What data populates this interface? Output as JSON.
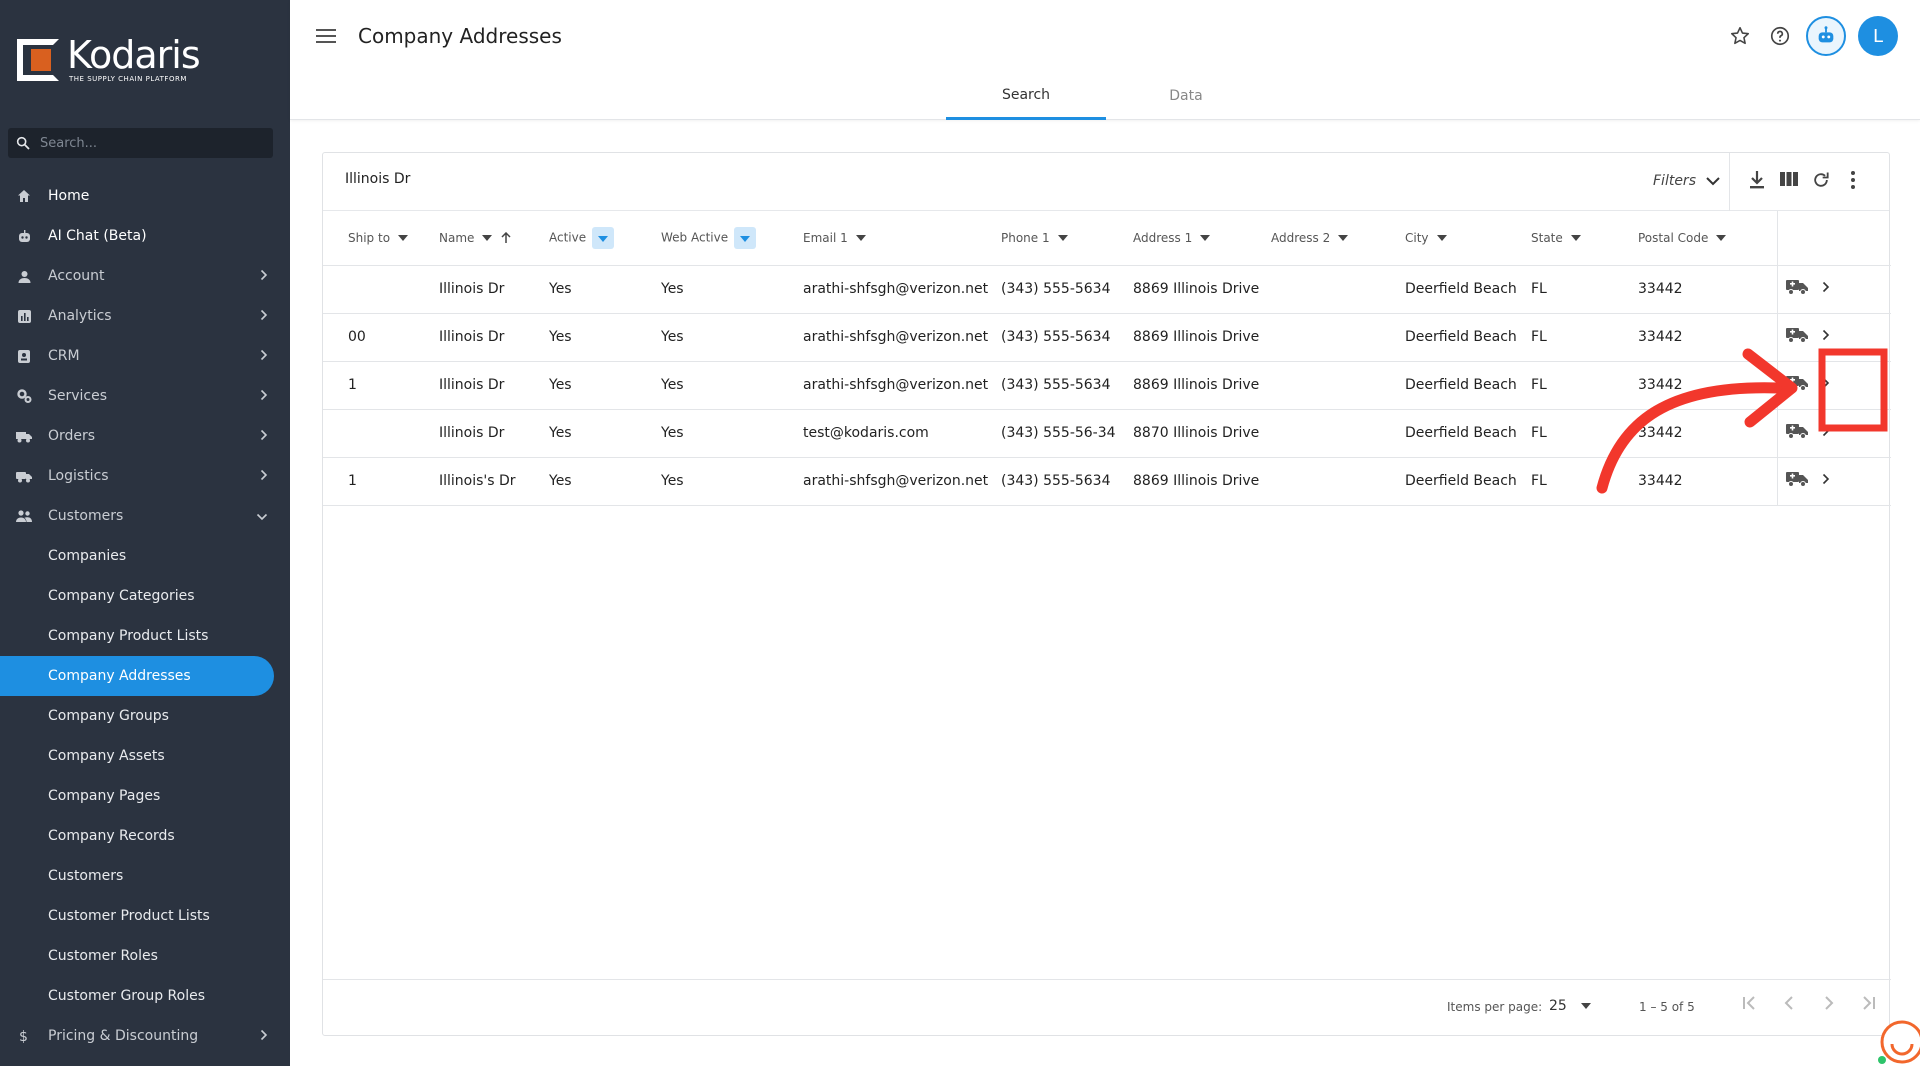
{
  "app": {
    "brand": "Kodaris",
    "tagline": "THE SUPPLY CHAIN PLATFORM"
  },
  "sidebar": {
    "search_placeholder": "Search...",
    "items": [
      {
        "label": "Home",
        "icon": "home-icon",
        "chevron": false
      },
      {
        "label": "AI Chat (Beta)",
        "icon": "robot-icon",
        "chevron": false
      },
      {
        "label": "Account",
        "icon": "person-icon",
        "chevron": true
      },
      {
        "label": "Analytics",
        "icon": "analytics-icon",
        "chevron": true
      },
      {
        "label": "CRM",
        "icon": "contact-icon",
        "chevron": true
      },
      {
        "label": "Services",
        "icon": "services-icon",
        "chevron": true
      },
      {
        "label": "Orders",
        "icon": "truck-icon",
        "chevron": true
      },
      {
        "label": "Logistics",
        "icon": "logistics-icon",
        "chevron": true
      },
      {
        "label": "Customers",
        "icon": "people-icon",
        "chevron": true,
        "expanded": true
      }
    ],
    "sub_items": [
      "Companies",
      "Company Categories",
      "Company Product Lists",
      "Company Addresses",
      "Company Groups",
      "Company Assets",
      "Company Pages",
      "Company Records",
      "Customers",
      "Customer Product Lists",
      "Customer Roles",
      "Customer Group Roles"
    ],
    "active_sub": "Company Addresses",
    "bottom_item": {
      "label": "Pricing & Discounting",
      "icon": "dollar-icon"
    }
  },
  "header": {
    "title": "Company Addresses",
    "tabs": [
      "Search",
      "Data"
    ],
    "active_tab": "Search",
    "avatar_letter": "L"
  },
  "toolbar": {
    "search_value": "Illinois Dr",
    "filters_label": "Filters"
  },
  "table": {
    "columns": [
      "Ship to",
      "Name",
      "Active",
      "Web Active",
      "Email 1",
      "Phone 1",
      "Address 1",
      "Address 2",
      "City",
      "State",
      "Postal Code"
    ],
    "rows": [
      [
        "",
        "Illinois Dr",
        "Yes",
        "Yes",
        "arathi-shfsgh@verizon.net",
        "(343) 555-5634",
        "8869 Illinois Drive",
        "",
        "Deerfield Beach",
        "FL",
        "33442"
      ],
      [
        "00",
        "Illinois Dr",
        "Yes",
        "Yes",
        "arathi-shfsgh@verizon.net",
        "(343) 555-5634",
        "8869 Illinois Drive",
        "",
        "Deerfield Beach",
        "FL",
        "33442"
      ],
      [
        "1",
        "Illinois Dr",
        "Yes",
        "Yes",
        "arathi-shfsgh@verizon.net",
        "(343) 555-5634",
        "8869 Illinois Drive",
        "",
        "Deerfield Beach",
        "FL",
        "33442"
      ],
      [
        "",
        "Illinois Dr",
        "Yes",
        "Yes",
        "test@kodaris.com",
        "(343) 555-56-34",
        "8870 Illinois Drive",
        "",
        "Deerfield Beach",
        "FL",
        "33442"
      ],
      [
        "1",
        "Illinois's Dr",
        "Yes",
        "Yes",
        "arathi-shfsgh@verizon.net",
        "(343) 555-5634",
        "8869 Illinois Drive",
        "",
        "Deerfield Beach",
        "FL",
        "33442"
      ]
    ]
  },
  "paginator": {
    "items_per_page_label": "Items per page:",
    "items_per_page": "25",
    "range": "1 – 5 of 5"
  },
  "colors": {
    "sidebar_bg": "#2b3340",
    "accent": "#1e8fe1",
    "logo_orange": "#d9601f",
    "annotation_red": "#f2372c"
  }
}
